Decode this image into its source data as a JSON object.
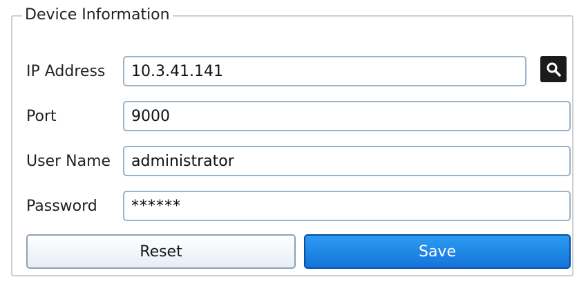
{
  "group": {
    "title": "Device Information"
  },
  "fields": {
    "ip": {
      "label": "IP Address",
      "value": "10.3.41.141"
    },
    "port": {
      "label": "Port",
      "value": "9000"
    },
    "username": {
      "label": "User Name",
      "value": "administrator"
    },
    "password": {
      "label": "Password",
      "value": "******"
    }
  },
  "icons": {
    "search": "search-icon"
  },
  "buttons": {
    "reset_label": "Reset",
    "save_label": "Save"
  },
  "colors": {
    "save_button": "#1a86e8",
    "field_border": "#9bb3c8",
    "search_button": "#1b1b1b"
  }
}
